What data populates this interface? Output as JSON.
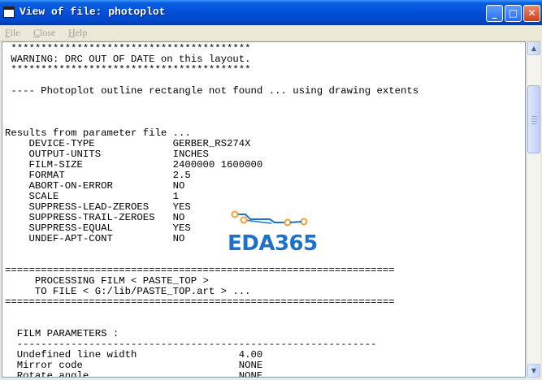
{
  "window": {
    "title": "View of file: photoplot",
    "buttons": {
      "minimize": "_",
      "maximize": "□",
      "close": "✕"
    }
  },
  "menu": [
    "File",
    "Close",
    "Help"
  ],
  "watermark": {
    "text": "EDA365",
    "color": "#1d71c8",
    "dot_color": "#f0a030"
  },
  "lines": [
    " ****************************************",
    " WARNING: DRC OUT OF DATE on this layout.",
    " ****************************************",
    "",
    " ---- Photoplot outline rectangle not found ... using drawing extents",
    "",
    "",
    "",
    "Results from parameter file ...",
    "    DEVICE-TYPE             GERBER_RS274X",
    "    OUTPUT-UNITS            INCHES",
    "    FILM-SIZE               2400000 1600000",
    "    FORMAT                  2.5",
    "    ABORT-ON-ERROR          NO",
    "    SCALE                   1",
    "    SUPPRESS-LEAD-ZEROES    YES",
    "    SUPPRESS-TRAIL-ZEROES   NO",
    "    SUPPRESS-EQUAL          YES",
    "    UNDEF-APT-CONT          NO",
    "",
    "",
    "=================================================================",
    "     PROCESSING FILM < PASTE_TOP >",
    "     TO FILE < G:/lib/PASTE_TOP.art > ...",
    "=================================================================",
    "",
    "",
    "  FILM PARAMETERS :",
    "  ------------------------------------------------------------",
    "  Undefined line width                 4.00",
    "  Mirror code                          NONE",
    "  Rotate angle                         NONE"
  ],
  "scrollbar": {
    "up": "▲",
    "down": "▼"
  }
}
